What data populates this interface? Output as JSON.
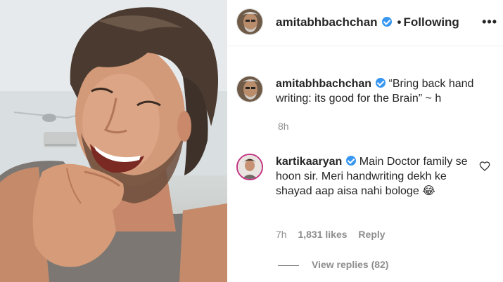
{
  "header": {
    "username": "amitabhbachchan",
    "separator": "•",
    "follow_status": "Following",
    "more_label": "•••"
  },
  "caption": {
    "username": "amitabhbachchan",
    "text": "“Bring back hand writing: its good for the Brain” ~ h",
    "time": "8h"
  },
  "reply": {
    "username": "kartikaaryan",
    "text": "Main Doctor family se hoon sir. Meri handwriting dekh ke shayad aap aisa nahi bologe 😂",
    "time": "7h",
    "likes": "1,831 likes",
    "reply_label": "Reply"
  },
  "view_replies": "View replies (82)",
  "colors": {
    "verified": "#3897f0",
    "muted_text": "#8e8e8e",
    "main_text": "#262626"
  },
  "icons": [
    "verified-badge-icon",
    "more-options-icon",
    "heart-icon"
  ]
}
